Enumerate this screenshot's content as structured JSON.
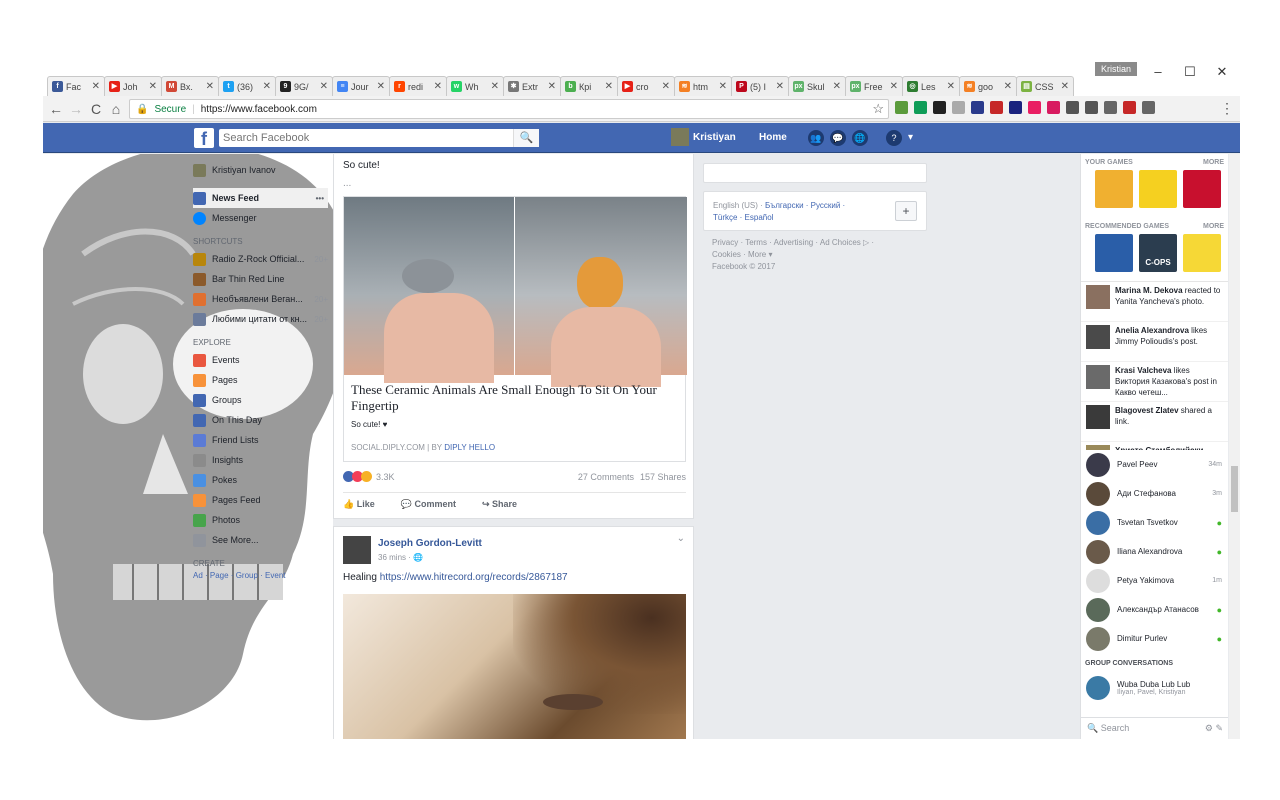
{
  "browser": {
    "profile_name": "Kristian",
    "minimize": "–",
    "maximize": "☐",
    "close": "✕",
    "tabs": [
      {
        "label": "Fac",
        "icon_color": "#3b5998",
        "glyph": "f"
      },
      {
        "label": "Joh",
        "icon_color": "#e62117",
        "glyph": "▶"
      },
      {
        "label": "Вх.",
        "icon_color": "#d14836",
        "glyph": "M"
      },
      {
        "label": "(36)",
        "icon_color": "#1da1f2",
        "glyph": "t"
      },
      {
        "label": "9G/",
        "icon_color": "#222222",
        "glyph": "9"
      },
      {
        "label": "Jour",
        "icon_color": "#4285f4",
        "glyph": "≡"
      },
      {
        "label": "redi",
        "icon_color": "#ff4500",
        "glyph": "r"
      },
      {
        "label": "Wh",
        "icon_color": "#25d366",
        "glyph": "w"
      },
      {
        "label": "Extr",
        "icon_color": "#777777",
        "glyph": "✱"
      },
      {
        "label": "Крi",
        "icon_color": "#4caf50",
        "glyph": "b"
      },
      {
        "label": "cro",
        "icon_color": "#e62117",
        "glyph": "▶"
      },
      {
        "label": "htm",
        "icon_color": "#f48024",
        "glyph": "≋"
      },
      {
        "label": "(5) I",
        "icon_color": "#bd081c",
        "glyph": "P"
      },
      {
        "label": "Skul",
        "icon_color": "#5fb36b",
        "glyph": "px"
      },
      {
        "label": "Free",
        "icon_color": "#5fb36b",
        "glyph": "px"
      },
      {
        "label": "Les",
        "icon_color": "#2e7d32",
        "glyph": "◎"
      },
      {
        "label": "goo",
        "icon_color": "#f48024",
        "glyph": "≋"
      },
      {
        "label": "CSS",
        "icon_color": "#7cb342",
        "glyph": "▤"
      }
    ],
    "tab_close": "✕",
    "back": "←",
    "forward": "→",
    "reload": "C",
    "home": "⌂",
    "secure_label": "Secure",
    "url": "https://www.facebook.com",
    "star": "☆",
    "menu": "⋮",
    "ext_colors": [
      "#5b9b3c",
      "#0f9d58",
      "#222222",
      "#aaaaaa",
      "#2a3a8c",
      "#c62828",
      "#1a237e",
      "#e91e63",
      "#d81b60",
      "#555555",
      "#555555",
      "#666666",
      "#c62828",
      "#666666"
    ]
  },
  "fb": {
    "logo": "f",
    "search_placeholder": "Search Facebook",
    "search_icon": "🔍",
    "user": "Kristiyan",
    "home": "Home",
    "friends_icon": "👥",
    "messages_icon": "💬",
    "globe_icon": "🌐",
    "help_icon": "?",
    "caret": "▾"
  },
  "leftnav": {
    "profile": "Kristiyan Ivanov",
    "news_feed": "News Feed",
    "more": "•••",
    "messenger": "Messenger",
    "shortcuts_head": "SHORTCUTS",
    "shortcuts": [
      {
        "label": "Radio Z-Rock Official...",
        "count": "20+",
        "color": "#b8860b"
      },
      {
        "label": "Bar Thin Red Line",
        "count": "",
        "color": "#8b5a2b"
      },
      {
        "label": "Необъявлени Веган...",
        "count": "20+",
        "color": "#e07030"
      },
      {
        "label": "Любими цитати от кн...",
        "count": "20+",
        "color": "#6b7b9b"
      }
    ],
    "explore_head": "EXPLORE",
    "explore": [
      {
        "label": "Events",
        "color": "#e9573f"
      },
      {
        "label": "Pages",
        "color": "#f7923a"
      },
      {
        "label": "Groups",
        "color": "#4267b2"
      },
      {
        "label": "On This Day",
        "color": "#4267b2"
      },
      {
        "label": "Friend Lists",
        "color": "#5b7bd5"
      },
      {
        "label": "Insights",
        "color": "#8b8b8b"
      },
      {
        "label": "Pokes",
        "color": "#4a90e2"
      },
      {
        "label": "Pages Feed",
        "color": "#f7923a"
      },
      {
        "label": "Photos",
        "color": "#47a44b"
      },
      {
        "label": "See More...",
        "color": "#90949c"
      }
    ],
    "create_head": "CREATE",
    "create_links": "Ad · Page · Group · Event"
  },
  "feed": {
    "post1": {
      "text": "So cute!",
      "ellipsis": "...",
      "link_title": "These Ceramic Animals Are Small Enough To Sit On Your Fingertip",
      "link_desc": "So cute! ♥",
      "link_source": "SOCIAL.DIPLY.COM  |  BY ",
      "link_author": "DIPLY HELLO",
      "reactions": "3.3K",
      "comments": "27 Comments",
      "shares": "157 Shares",
      "like": "Like",
      "comment": "Comment",
      "share": "Share"
    },
    "post2": {
      "author": "Joseph Gordon-Levitt",
      "time": "36 mins · 🌐",
      "text": "Healing ",
      "link": "https://www.hitrecord.org/records/2867187",
      "chevron": "⌄"
    }
  },
  "right": {
    "lang_current": "English (US) · ",
    "lang_others": "Български · Русский · Türkçe · Español",
    "plus": "+",
    "footer": "Privacy · Terms · Advertising · Ad Choices ▷ · Cookies · More ▾",
    "copyright": "Facebook © 2017"
  },
  "chat": {
    "your_games": "YOUR GAMES",
    "more": "MORE",
    "recommended": "RECOMMENDED GAMES",
    "game_colors": [
      "#f0b030",
      "#f5d020",
      "#c8102e"
    ],
    "rec_colors": [
      "#2a5ea8",
      "#2b3d4f",
      "#f6d836"
    ],
    "rec_label_cops": "C-OPS",
    "ticker": [
      {
        "name": "Marina M. Dekova",
        "rest": " reacted to Yanita Yancheva's photo."
      },
      {
        "name": "Anelia Alexandrova",
        "rest": " likes Jimmy Polioudis's post."
      },
      {
        "name": "Krasi Valcheva",
        "rest": " likes Виктория Казакова's post in Какво четеш..."
      },
      {
        "name": "Blagovest Zlatev",
        "rest": " shared a link."
      },
      {
        "name": "Христо Стамболийски",
        "rest": ""
      }
    ],
    "contacts": [
      {
        "name": "Pavel Peev",
        "status": "34m",
        "color": "#3a3a4a"
      },
      {
        "name": "Ади Стефанова",
        "status": "3m",
        "color": "#5a4a3a"
      },
      {
        "name": "Tsvetan Tsvetkov",
        "status": "●",
        "color": "#3a6ea5"
      },
      {
        "name": "Iliana Alexandrova",
        "status": "●",
        "color": "#6a5a4a"
      },
      {
        "name": "Petya Yakimova",
        "status": "1m",
        "color": "#dddddd"
      },
      {
        "name": "Александър Атанасов",
        "status": "●",
        "color": "#5a6a5a"
      },
      {
        "name": "Dimitur Purlev",
        "status": "●",
        "color": "#7a7a6a"
      }
    ],
    "group_head": "GROUP CONVERSATIONS",
    "group_name": "Wuba Duba Lub Lub",
    "group_members": "Iliyan, Pavel, Kristiyan",
    "search": "🔍 Search",
    "search_icons": "⚙ ✎"
  }
}
